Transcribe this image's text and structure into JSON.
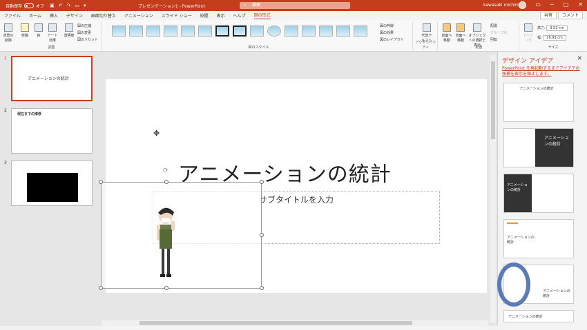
{
  "titlebar": {
    "autosave_label": "自動保存",
    "autosave_state": "オフ",
    "doc_title": "プレゼンテーション1 - PowerPoint",
    "search_placeholder": "検索",
    "user_name": "kawasaki michiro"
  },
  "tabs": [
    "ファイル",
    "ホーム",
    "挿入",
    "デザイン",
    "画面切り替え",
    "アニメーション",
    "スライド ショー",
    "校閲",
    "表示",
    "ヘルプ",
    "図の形式"
  ],
  "active_tab": "図の形式",
  "share_label": "共有",
  "comment_label": "コメント",
  "ribbon": {
    "adjust": {
      "label": "調整",
      "buttons": [
        "背景の削除",
        "修整",
        "色",
        "アート効果",
        "透明度"
      ],
      "small": [
        "図の圧縮",
        "図の変更",
        "図のリセット"
      ]
    },
    "styles": {
      "label": "図のスタイル",
      "small": [
        "図の枠線",
        "図の効果",
        "図のレイアウト"
      ]
    },
    "accessibility": {
      "label": "アクセシビリティ",
      "button": "代替テキスト"
    },
    "arrange": {
      "label": "配置",
      "buttons": [
        "前面へ移動",
        "背面へ移動",
        "オブジェクトの選択と表示"
      ],
      "small": [
        "配置",
        "グループ化",
        "回転"
      ]
    },
    "size": {
      "label": "サイズ",
      "crop": "トリミング",
      "height_label": "高さ:",
      "height": "9.53 cm",
      "width_label": "幅:",
      "width": "16.93 cm"
    }
  },
  "slides": [
    {
      "num": "1"
    },
    {
      "num": "2",
      "title": "現在までの推移"
    },
    {
      "num": "3"
    }
  ],
  "slide": {
    "title": "アニメーションの統計",
    "subtitle": "サブタイトルを入力"
  },
  "design": {
    "title": "デザイン アイデア",
    "close": "×",
    "message": "PowerPoint を再起動するまでアイデアの候補を表示を保止します。"
  },
  "ideas": [
    {
      "text": "アニメーションの統計"
    },
    {
      "text": "アニメーションの統計"
    },
    {
      "text": "アニメーションの統計"
    },
    {
      "text": "アニメーションの統計"
    },
    {
      "text": "アニメーションの統計"
    },
    {
      "text": "アニメーションの統計"
    }
  ]
}
